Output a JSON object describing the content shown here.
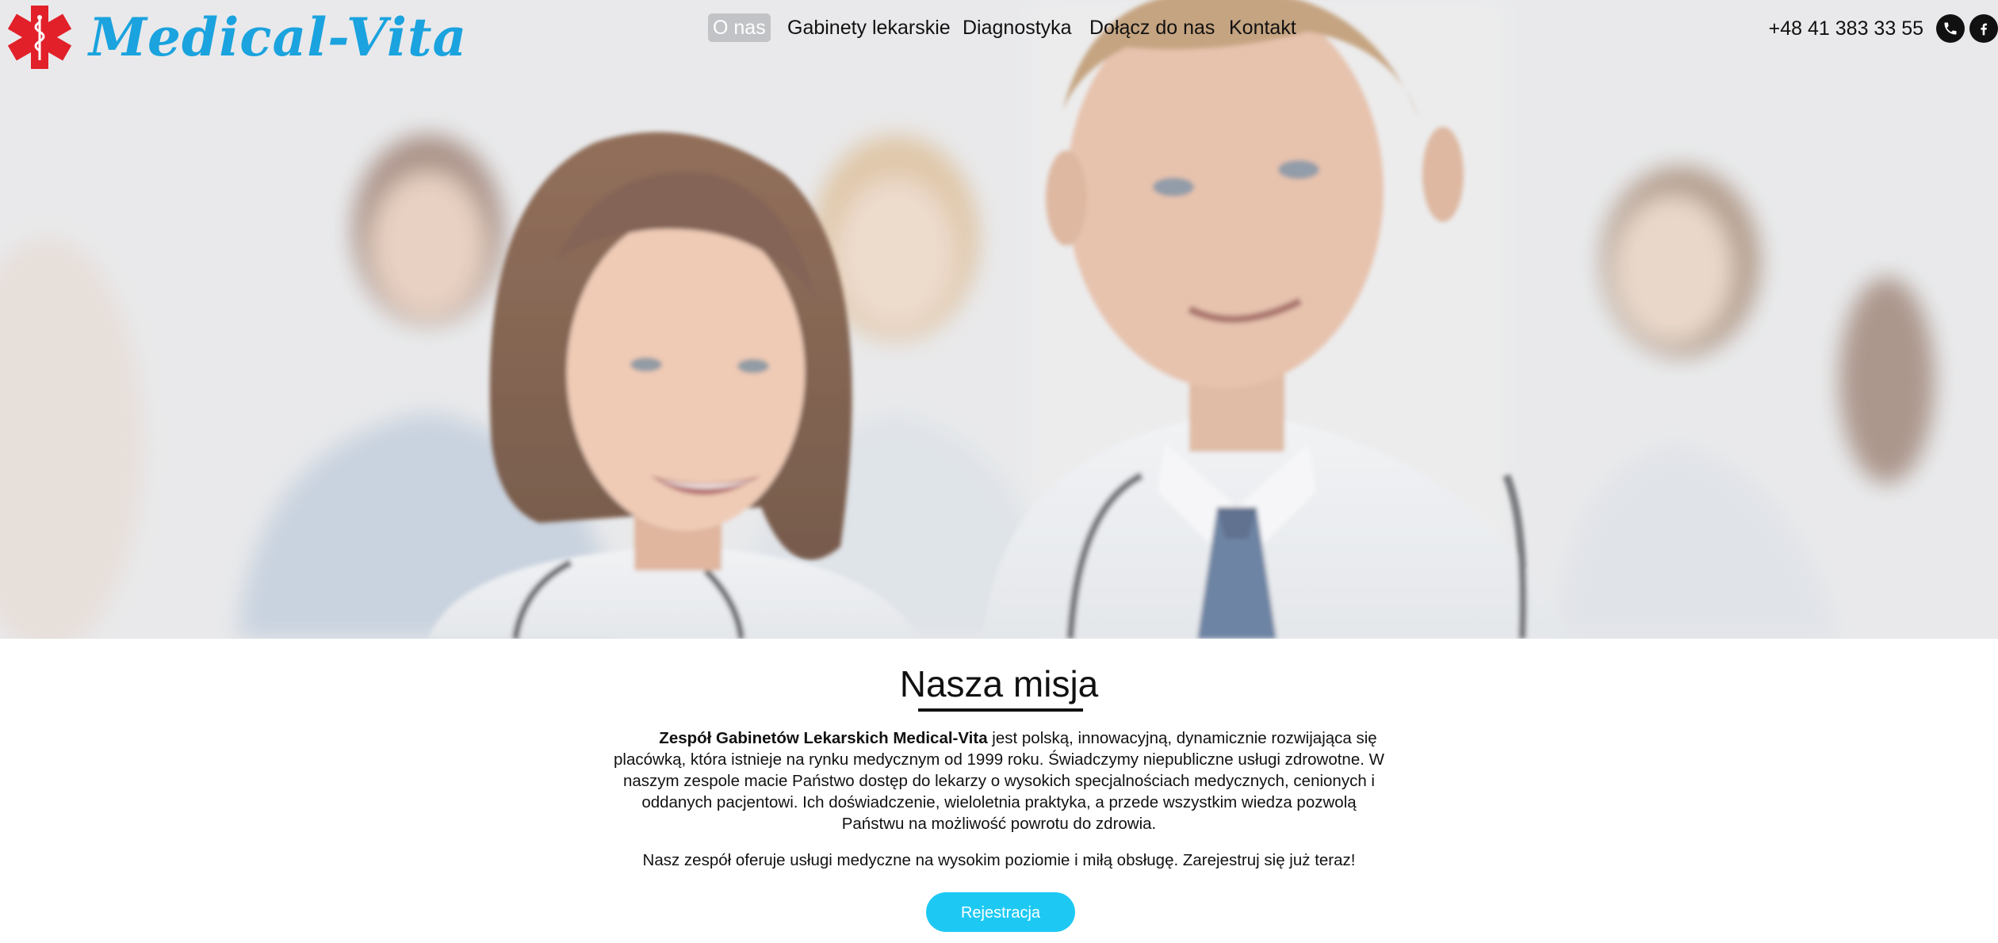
{
  "brand": {
    "name": "Medical-Vita",
    "logo_icon": "star-of-life-icon",
    "colors": {
      "logo_text": "#1aa3de",
      "logo_mark": "#e2202a"
    }
  },
  "nav": {
    "items": [
      {
        "label": "O nas",
        "active": true
      },
      {
        "label": "Gabinety lekarskie",
        "active": false
      },
      {
        "label": "Diagnostyka",
        "active": false
      },
      {
        "label": "Dołącz do nas",
        "active": false
      },
      {
        "label": "Kontakt",
        "active": false
      }
    ]
  },
  "contact": {
    "phone": "+48 41 383 33 55",
    "icons": [
      "phone-icon",
      "facebook-icon"
    ]
  },
  "hero": {
    "image": "smiling-doctors-team-photo"
  },
  "mission": {
    "title": "Nasza misja",
    "p1_bold": "Zespół Gabinetów Lekarskich Medical-Vita",
    "p1_rest": " jest polską, innowacyjną, dynamicznie rozwijająca się placówką, która istnieje na rynku medycznym od 1999 roku. Świadczymy niepubliczne usługi zdrowotne. W naszym zespole macie Państwo dostęp do lekarzy o wysokich specjalnościach medycznych, cenionych i oddanych pacjentowi. Ich doświadczenie, wieloletnia praktyka, a przede wszystkim wiedza pozwolą Państwu na możliwość powrotu do zdrowia.",
    "p2": "Nasz zespół oferuje usługi medyczne na wysokim poziomie i miłą obsługę. Zarejestruj się już teraz!",
    "cta_label": "Rejestracja",
    "colors": {
      "cta": "#1dc9f3"
    }
  }
}
